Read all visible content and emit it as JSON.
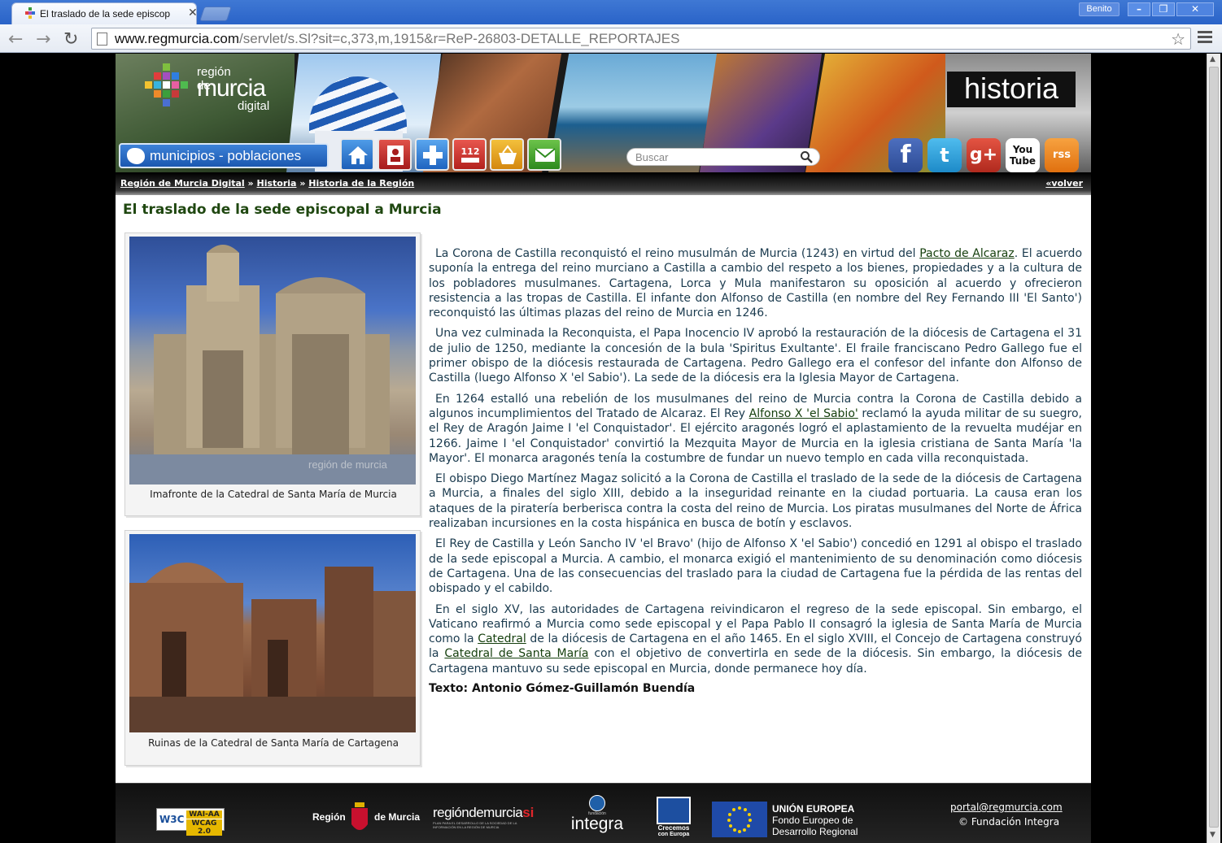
{
  "browser": {
    "tab_title": "El traslado de la sede episcop",
    "user": "Benito",
    "url_host": "www.regmurcia.com",
    "url_path": "/servlet/s.Sl?sit=c,373,m,1915&r=ReP-26803-DETALLE_REPORTAJES"
  },
  "banner": {
    "logo_line1": "región de",
    "logo_line2": "murcia",
    "logo_line3": "digital",
    "municipios_label": "municipios - poblaciones",
    "search_placeholder": "Buscar",
    "section_label": "historia",
    "quick_icons": [
      "home-icon",
      "contact-card-icon",
      "health-cross-icon",
      "emergency-112-icon",
      "shopping-basket-icon",
      "mail-icon"
    ],
    "emergency_label": "112",
    "social": [
      {
        "name": "facebook",
        "glyph": "f",
        "color": "#3b5ba8"
      },
      {
        "name": "twitter",
        "glyph": "t",
        "color": "#2ea1dc"
      },
      {
        "name": "googleplus",
        "glyph": "g+",
        "color": "#cf3c2c"
      },
      {
        "name": "youtube",
        "glyph": "You Tube",
        "color": "#ffffff"
      },
      {
        "name": "rss",
        "glyph": "rss",
        "color": "#f08a1e"
      }
    ]
  },
  "breadcrumb": {
    "items": [
      "Región de Murcia Digital",
      "Historia",
      "Historia de la Región"
    ],
    "separator": "»",
    "back": "«volver"
  },
  "article": {
    "title": "El traslado de la sede episcopal a Murcia",
    "figures": [
      {
        "caption": "Imafronte de la Catedral de Santa María de Murcia",
        "watermark": "región de murcia"
      },
      {
        "caption": "Ruinas de la Catedral de Santa María de Cartagena"
      }
    ],
    "p1_a": "La Corona de Castilla reconquistó el reino musulmán de Murcia (1243) en virtud del ",
    "p1_link": "Pacto de Alcaraz",
    "p1_b": ". El acuerdo suponía la entrega del reino murciano a Castilla a cambio del respeto a los bienes, propiedades y a la cultura de los pobladores musulmanes. Cartagena, Lorca y Mula manifestaron su oposición al acuerdo y ofrecieron resistencia a las tropas de Castilla. El infante don Alfonso de Castilla (en nombre del Rey Fernando III 'El Santo') reconquistó las últimas plazas del reino de Murcia en 1246.",
    "p2": "Una vez culminada la Reconquista, el Papa Inocencio IV aprobó la restauración de la diócesis de Cartagena el 31 de julio de 1250, mediante la concesión de la bula 'Spiritus Exultante'. El fraile franciscano Pedro Gallego fue el primer obispo de la diócesis restaurada de Cartagena. Pedro Gallego era el confesor del infante don Alfonso de Castilla (luego Alfonso X 'el Sabio'). La sede de la diócesis era la Iglesia Mayor de Cartagena.",
    "p3_a": "En 1264 estalló una rebelión de los musulmanes del reino de Murcia contra la Corona de Castilla debido a algunos incumplimientos del Tratado de Alcaraz. El Rey ",
    "p3_link": "Alfonso X 'el Sabio'",
    "p3_b": " reclamó la ayuda militar de su suegro, el Rey de Aragón Jaime I 'el Conquistador'. El ejército aragonés logró el aplastamiento de la revuelta mudéjar en 1266. Jaime I 'el Conquistador' convirtió la Mezquita Mayor de Murcia en la iglesia cristiana de Santa María 'la Mayor'. El monarca aragonés tenía la costumbre de fundar un nuevo templo en cada villa reconquistada.",
    "p4": "El obispo Diego Martínez Magaz solicitó a la Corona de Castilla el traslado de la sede de la diócesis de Cartagena a Murcia, a finales del siglo XIII, debido a la inseguridad reinante en la ciudad portuaria. La causa eran los ataques de la piratería berberisca contra la costa del reino de Murcia. Los piratas musulmanes del Norte de África realizaban incursiones en la costa hispánica en busca de botín y esclavos.",
    "p5": "El Rey de Castilla y León Sancho IV 'el Bravo' (hijo de Alfonso X 'el Sabio') concedió en 1291 al obispo el traslado de la sede episcopal a Murcia. A cambio, el monarca exigió el mantenimiento de su denominación como diócesis de Cartagena. Una de las consecuencias del traslado para la ciudad de Cartagena fue la pérdida de las rentas del obispado y el cabildo.",
    "p6_a": "En el siglo XV, las autoridades de Cartagena reivindicaron el regreso de la sede episcopal. Sin embargo, el Vaticano reafirmó a Murcia como sede episcopal y el Papa Pablo II consagró la iglesia de Santa María de Murcia como la ",
    "p6_link1": "Catedral",
    "p6_b": " de la diócesis de Cartagena en el año 1465. En el siglo XVIII, el Concejo de Cartagena construyó la ",
    "p6_link2": "Catedral de Santa María",
    "p6_c": " con el objetivo de convertirla en sede de la diócesis. Sin embargo, la diócesis de Cartagena mantuvo su sede episcopal en Murcia, donde permanece hoy día.",
    "credit": "Texto: Antonio Gómez-Guillamón Buendía"
  },
  "footer": {
    "w3c": "W3C",
    "wai": "WAI-AA",
    "wcag": "WCAG 2.0",
    "region_a": "Región",
    "region_b": "de Murcia",
    "regiondemurcia": "regióndemurcia",
    "regiondemurcia_si": "si",
    "regiondemurcia_sub": "PLAN PARA EL DESARROLLO DE LA SOCIEDAD DE LA INFORMACIÓN EN LA REGIÓN DE MURCIA",
    "integra_small": "fundación",
    "integra": "integra",
    "crecemos_a": "Crecemos",
    "crecemos_b": "con Europa",
    "eu_title": "UNIÓN EUROPEA",
    "eu_line2": "Fondo Europeo de",
    "eu_line3": "Desarrollo Regional",
    "email": "portal@regmurcia.com",
    "copyright": "© Fundación Integra"
  }
}
